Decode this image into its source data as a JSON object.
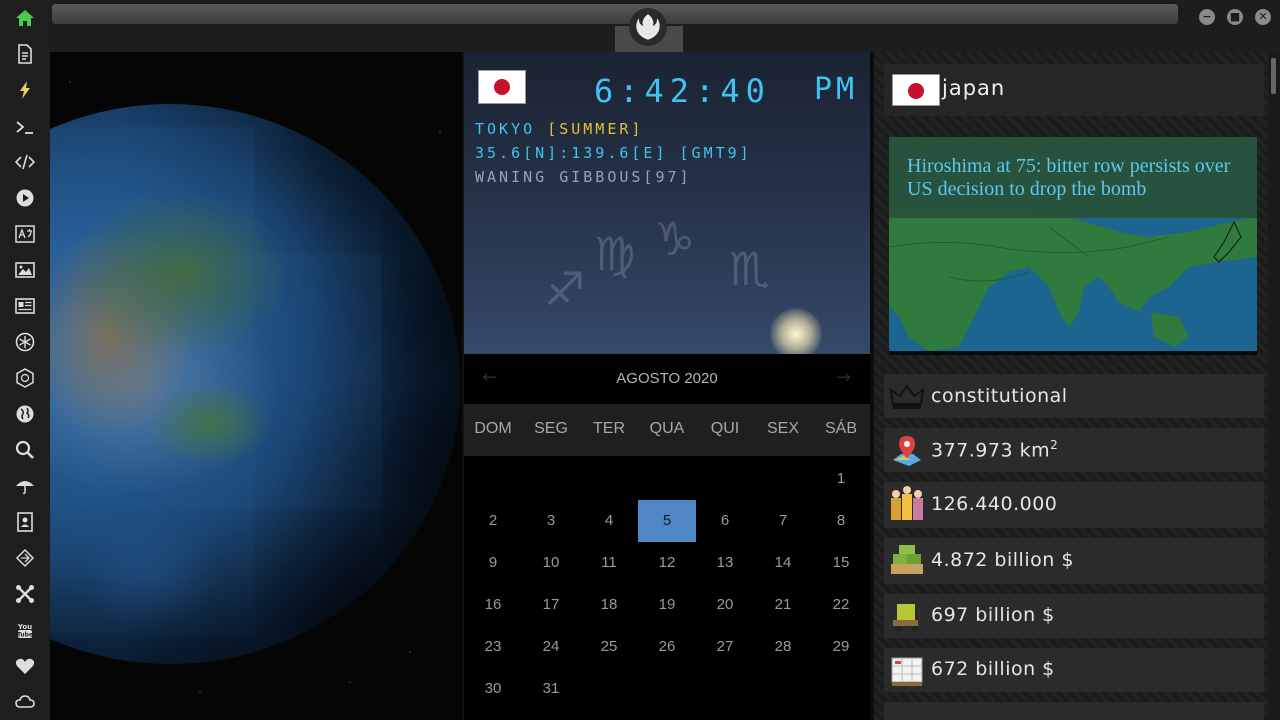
{
  "window": {
    "controls": {
      "minimize": "−",
      "maximize": "■",
      "close": "✕"
    }
  },
  "sidebar": {
    "icons": [
      "home-icon",
      "document-icon",
      "lightning-icon",
      "terminal-icon",
      "code-icon",
      "play-icon",
      "translate-icon",
      "image-icon",
      "news-icon",
      "rebel-icon",
      "empire-icon",
      "globe-icon",
      "search-icon",
      "umbrella-icon",
      "contacts-icon",
      "network-icon",
      "tools-icon",
      "youtube-icon",
      "heart-icon",
      "cloud-icon"
    ],
    "accent": "#4cc94c"
  },
  "clock": {
    "time": "6:42:40",
    "ampm": "PM",
    "city": "TOKYO",
    "season": "[SUMMER]",
    "coords": "35.6[N]:139.6[E] [GMT9]",
    "moon": "WANING GIBBOUS[97]",
    "color": "#3fc3f0"
  },
  "calendar": {
    "prev": "←",
    "next": "→",
    "month": "AGOSTO 2020",
    "weekdays": [
      "DOM",
      "SEG",
      "TER",
      "QUA",
      "QUI",
      "SEX",
      "SÁB"
    ],
    "today": "5",
    "days": [
      "1",
      "2",
      "3",
      "4",
      "5",
      "6",
      "7",
      "8",
      "9",
      "10",
      "11",
      "12",
      "13",
      "14",
      "15",
      "16",
      "17",
      "18",
      "19",
      "20",
      "21",
      "22",
      "23",
      "24",
      "25",
      "26",
      "27",
      "28",
      "29",
      "30",
      "31"
    ],
    "today_color": "#4e86c6"
  },
  "country": {
    "name": "japan",
    "news": {
      "headline": "Hiroshima at 75: bitter row persists over US decision to drop the bomb"
    },
    "stats": {
      "government": "constitutional",
      "area": "377.973 km",
      "area_unit_sup": "2",
      "population": "126.440.000",
      "gdp": "4.872 billion $",
      "exports": "697 billion $",
      "imports": "672 billion $"
    }
  }
}
